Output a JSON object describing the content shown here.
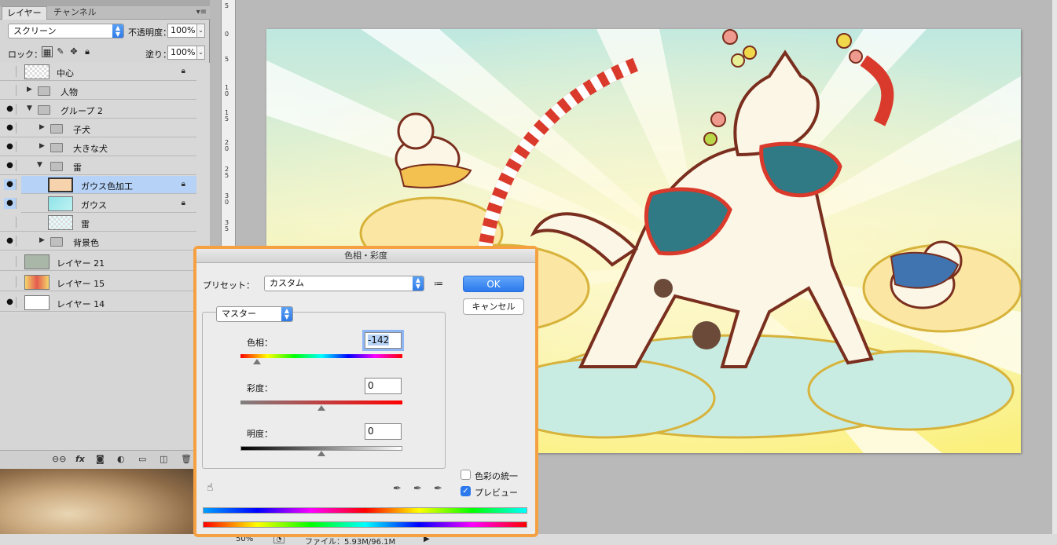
{
  "layers_panel": {
    "tabs": [
      "レイヤー",
      "チャンネル"
    ],
    "blend_mode": "スクリーン",
    "opacity_label": "不透明度：",
    "opacity_value": "100%",
    "lock_label": "ロック：",
    "fill_label": "塗り：",
    "fill_value": "100%",
    "layers": [
      {
        "name": "中心",
        "visible": false,
        "kind": "layer",
        "locked": true
      },
      {
        "name": "人物",
        "visible": false,
        "kind": "group-collapsed"
      },
      {
        "name": "グループ 2",
        "visible": true,
        "kind": "group-open"
      },
      {
        "name": "子犬",
        "visible": true,
        "kind": "group-collapsed"
      },
      {
        "name": "大きな犬",
        "visible": true,
        "kind": "group-collapsed"
      },
      {
        "name": "雷",
        "visible": true,
        "kind": "group-open"
      },
      {
        "name": "ガウス色加工",
        "visible": true,
        "kind": "layer",
        "locked": true,
        "selected": true
      },
      {
        "name": "ガウス",
        "visible": true,
        "kind": "layer",
        "locked": true
      },
      {
        "name": "雷",
        "visible": false,
        "kind": "layer"
      },
      {
        "name": "背景色",
        "visible": true,
        "kind": "group-collapsed"
      },
      {
        "name": "レイヤー 21",
        "visible": false,
        "kind": "layer"
      },
      {
        "name": "レイヤー 15",
        "visible": false,
        "kind": "layer"
      },
      {
        "name": "レイヤー 14",
        "visible": true,
        "kind": "layer"
      }
    ]
  },
  "ruler": {
    "marks": [
      "5",
      "0",
      "5",
      "1 0",
      "1 5",
      "2 0",
      "2 5",
      "3 0",
      "3 5"
    ]
  },
  "status_bar": {
    "zoom": "50%",
    "file_info": "ファイル：5.93M/96.1M"
  },
  "dialog": {
    "title": "色相・彩度",
    "preset_label": "プリセット：",
    "preset_value": "カスタム",
    "ok_label": "OK",
    "cancel_label": "キャンセル",
    "channel_value": "マスター",
    "hue_label": "色相：",
    "hue_value": "-142",
    "hue_position": 0.1,
    "saturation_label": "彩度：",
    "saturation_value": "0",
    "saturation_position": 0.5,
    "lightness_label": "明度：",
    "lightness_value": "0",
    "lightness_position": 0.5,
    "colorize_label": "色彩の統一",
    "colorize_checked": false,
    "preview_label": "プレビュー",
    "preview_checked": true
  },
  "colors": {
    "dialog_highlight": "#f5a142",
    "accent": "#2b79ed",
    "selected_row": "#b6d3f7"
  }
}
